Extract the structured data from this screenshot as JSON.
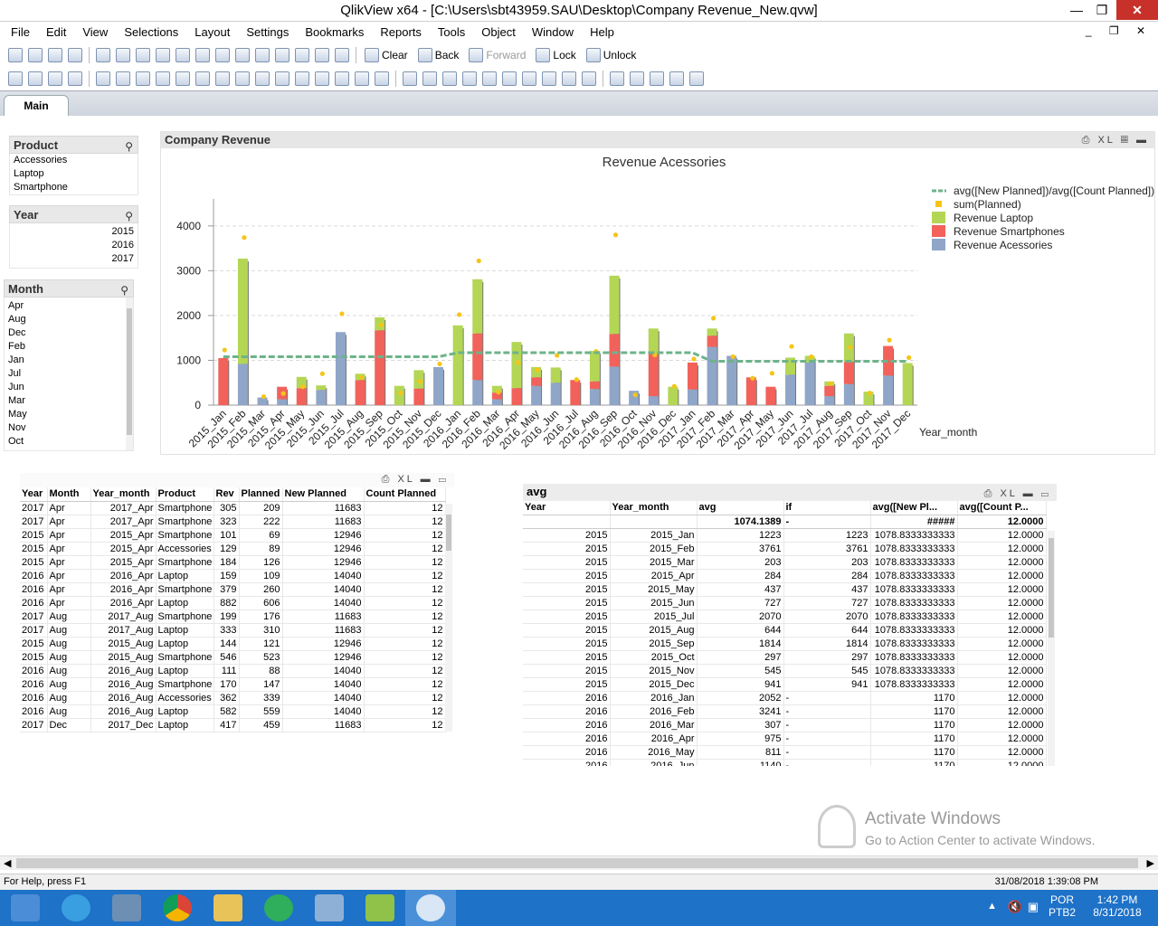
{
  "window": {
    "title": "QlikView x64 - [C:\\Users\\sbt43959.SAU\\Desktop\\Company Revenue_New.qvw]",
    "controls": [
      "—",
      "❐",
      "✕"
    ],
    "mdi_controls": "_ ❐ ✕"
  },
  "menu": [
    "File",
    "Edit",
    "View",
    "Selections",
    "Layout",
    "Settings",
    "Bookmarks",
    "Reports",
    "Tools",
    "Object",
    "Window",
    "Help"
  ],
  "toolbar": {
    "clear": "Clear",
    "back": "Back",
    "forward": "Forward",
    "lock": "Lock",
    "unlock": "Unlock"
  },
  "tabs": [
    {
      "label": "Main"
    }
  ],
  "listboxes": {
    "product": {
      "title": "Product",
      "items": [
        "Accessories",
        "Laptop",
        "Smartphone"
      ]
    },
    "year": {
      "title": "Year",
      "items": [
        "2015",
        "2016",
        "2017"
      ]
    },
    "month": {
      "title": "Month",
      "items": [
        "Apr",
        "Aug",
        "Dec",
        "Feb",
        "Jan",
        "Jul",
        "Jun",
        "Mar",
        "May",
        "Nov",
        "Oct"
      ]
    }
  },
  "chart_object": {
    "caption": "Company Revenue",
    "caption_controls": "XL"
  },
  "chart_data": {
    "type": "bar",
    "title": "Revenue Acessories",
    "xlabel": "Year_month",
    "ylabel": "",
    "ylim": [
      0,
      4400
    ],
    "yticks": [
      0,
      1000,
      2000,
      3000,
      4000
    ],
    "grid": true,
    "legend_position": "top-right",
    "stacked": true,
    "categories": [
      "2015_Jan",
      "2015_Feb",
      "2015_Mar",
      "2015_Apr",
      "2015_May",
      "2015_Jun",
      "2015_Jul",
      "2015_Aug",
      "2015_Sep",
      "2015_Oct",
      "2015_Nov",
      "2015_Dec",
      "2016_Jan",
      "2016_Feb",
      "2016_Mar",
      "2016_Apr",
      "2016_May",
      "2016_Jun",
      "2016_Jul",
      "2016_Aug",
      "2016_Sep",
      "2016_Oct",
      "2016_Nov",
      "2016_Dec",
      "2017_Jan",
      "2017_Feb",
      "2017_Mar",
      "2017_Apr",
      "2017_May",
      "2017_Jun",
      "2017_Jul",
      "2017_Aug",
      "2017_Sep",
      "2017_Oct",
      "2017_Nov",
      "2017_Dec"
    ],
    "series": [
      {
        "name": "Revenue Acessories",
        "kind": "bar",
        "color": "#8fa6c9",
        "values": [
          0,
          920,
          170,
          130,
          0,
          340,
          1630,
          0,
          0,
          0,
          0,
          850,
          0,
          560,
          130,
          0,
          430,
          500,
          0,
          360,
          860,
          320,
          200,
          0,
          350,
          1300,
          1100,
          0,
          0,
          680,
          950,
          200,
          470,
          0,
          660,
          0
        ]
      },
      {
        "name": "Revenue Smartphones",
        "kind": "bar",
        "color": "#f2625a",
        "values": [
          1050,
          0,
          0,
          280,
          380,
          0,
          0,
          560,
          1670,
          0,
          370,
          0,
          0,
          1040,
          150,
          380,
          190,
          0,
          560,
          170,
          730,
          0,
          950,
          0,
          600,
          250,
          0,
          620,
          410,
          0,
          0,
          230,
          500,
          0,
          660,
          0
        ]
      },
      {
        "name": "Revenue Laptop",
        "kind": "bar",
        "color": "#b4d655",
        "values": [
          0,
          2350,
          0,
          0,
          250,
          100,
          0,
          140,
          290,
          430,
          410,
          0,
          1780,
          1210,
          150,
          1030,
          230,
          340,
          0,
          680,
          1300,
          0,
          560,
          410,
          0,
          160,
          0,
          0,
          0,
          380,
          150,
          100,
          630,
          300,
          0,
          940
        ]
      },
      {
        "name": "sum(Planned)",
        "kind": "point",
        "color": "#f5c518",
        "values": [
          1230,
          3740,
          190,
          260,
          410,
          700,
          2040,
          620,
          1790,
          270,
          530,
          920,
          2020,
          3220,
          290,
          950,
          790,
          1110,
          570,
          1200,
          3800,
          230,
          1120,
          420,
          1030,
          1940,
          1080,
          600,
          710,
          1310,
          1080,
          480,
          1290,
          270,
          1450,
          1060
        ]
      },
      {
        "name": "avg([New Planned])/avg([Count Planned])",
        "kind": "line",
        "color": "#6db38a",
        "values": [
          1078.83,
          1078.83,
          1078.83,
          1078.83,
          1078.83,
          1078.83,
          1078.83,
          1078.83,
          1078.83,
          1078.83,
          1078.83,
          1078.83,
          1170,
          1170,
          1170,
          1170,
          1170,
          1170,
          1170,
          1170,
          1170,
          1170,
          1170,
          1170,
          1170,
          978,
          978,
          978,
          978,
          978,
          978,
          978,
          978,
          978,
          978,
          978
        ]
      }
    ]
  },
  "table1": {
    "controls": "XL",
    "headers": [
      "Year",
      "Month",
      "Year_month",
      "Product",
      "Rev",
      "Planned",
      "New Planned",
      "Count Planned"
    ],
    "rows": [
      [
        "2017",
        "Apr",
        "2017_Apr",
        "Smartphone",
        "305",
        "209",
        "11683",
        "12"
      ],
      [
        "2017",
        "Apr",
        "2017_Apr",
        "Smartphone",
        "323",
        "222",
        "11683",
        "12"
      ],
      [
        "2015",
        "Apr",
        "2015_Apr",
        "Smartphone",
        "101",
        "69",
        "12946",
        "12"
      ],
      [
        "2015",
        "Apr",
        "2015_Apr",
        "Accessories",
        "129",
        "89",
        "12946",
        "12"
      ],
      [
        "2015",
        "Apr",
        "2015_Apr",
        "Smartphone",
        "184",
        "126",
        "12946",
        "12"
      ],
      [
        "2016",
        "Apr",
        "2016_Apr",
        "Laptop",
        "159",
        "109",
        "14040",
        "12"
      ],
      [
        "2016",
        "Apr",
        "2016_Apr",
        "Smartphone",
        "379",
        "260",
        "14040",
        "12"
      ],
      [
        "2016",
        "Apr",
        "2016_Apr",
        "Laptop",
        "882",
        "606",
        "14040",
        "12"
      ],
      [
        "2017",
        "Aug",
        "2017_Aug",
        "Smartphone",
        "199",
        "176",
        "11683",
        "12"
      ],
      [
        "2017",
        "Aug",
        "2017_Aug",
        "Laptop",
        "333",
        "310",
        "11683",
        "12"
      ],
      [
        "2015",
        "Aug",
        "2015_Aug",
        "Laptop",
        "144",
        "121",
        "12946",
        "12"
      ],
      [
        "2015",
        "Aug",
        "2015_Aug",
        "Smartphone",
        "546",
        "523",
        "12946",
        "12"
      ],
      [
        "2016",
        "Aug",
        "2016_Aug",
        "Laptop",
        "111",
        "88",
        "14040",
        "12"
      ],
      [
        "2016",
        "Aug",
        "2016_Aug",
        "Smartphone",
        "170",
        "147",
        "14040",
        "12"
      ],
      [
        "2016",
        "Aug",
        "2016_Aug",
        "Accessories",
        "362",
        "339",
        "14040",
        "12"
      ],
      [
        "2016",
        "Aug",
        "2016_Aug",
        "Laptop",
        "582",
        "559",
        "14040",
        "12"
      ],
      [
        "2017",
        "Dec",
        "2017_Dec",
        "Laptop",
        "417",
        "459",
        "11683",
        "12"
      ]
    ]
  },
  "table2": {
    "title": "avg",
    "controls": "XL",
    "headers": [
      "Year",
      "Year_month",
      "avg",
      "if",
      "avg([New Pl...",
      "avg([Count P..."
    ],
    "totals": [
      "",
      "",
      "1074.1389",
      "-",
      "#####",
      "12.0000"
    ],
    "rows": [
      [
        "2015",
        "2015_Jan",
        "1223",
        "1223",
        "1078.8333333333",
        "12.0000"
      ],
      [
        "2015",
        "2015_Feb",
        "3761",
        "3761",
        "1078.8333333333",
        "12.0000"
      ],
      [
        "2015",
        "2015_Mar",
        "203",
        "203",
        "1078.8333333333",
        "12.0000"
      ],
      [
        "2015",
        "2015_Apr",
        "284",
        "284",
        "1078.8333333333",
        "12.0000"
      ],
      [
        "2015",
        "2015_May",
        "437",
        "437",
        "1078.8333333333",
        "12.0000"
      ],
      [
        "2015",
        "2015_Jun",
        "727",
        "727",
        "1078.8333333333",
        "12.0000"
      ],
      [
        "2015",
        "2015_Jul",
        "2070",
        "2070",
        "1078.8333333333",
        "12.0000"
      ],
      [
        "2015",
        "2015_Aug",
        "644",
        "644",
        "1078.8333333333",
        "12.0000"
      ],
      [
        "2015",
        "2015_Sep",
        "1814",
        "1814",
        "1078.8333333333",
        "12.0000"
      ],
      [
        "2015",
        "2015_Oct",
        "297",
        "297",
        "1078.8333333333",
        "12.0000"
      ],
      [
        "2015",
        "2015_Nov",
        "545",
        "545",
        "1078.8333333333",
        "12.0000"
      ],
      [
        "2015",
        "2015_Dec",
        "941",
        "941",
        "1078.8333333333",
        "12.0000"
      ],
      [
        "2016",
        "2016_Jan",
        "2052",
        "-",
        "1170",
        "12.0000"
      ],
      [
        "2016",
        "2016_Feb",
        "3241",
        "-",
        "1170",
        "12.0000"
      ],
      [
        "2016",
        "2016_Mar",
        "307",
        "-",
        "1170",
        "12.0000"
      ],
      [
        "2016",
        "2016_Apr",
        "975",
        "-",
        "1170",
        "12.0000"
      ],
      [
        "2016",
        "2016_May",
        "811",
        "-",
        "1170",
        "12.0000"
      ],
      [
        "2016",
        "2016_Jun",
        "1140",
        "-",
        "1170",
        "12.0000"
      ]
    ]
  },
  "watermark": {
    "title": "Activate Windows",
    "subtitle": "Go to Action Center to activate Windows."
  },
  "status": {
    "help": "For Help, press F1",
    "datetime": "31/08/2018 1:39:08 PM"
  },
  "tray": {
    "lang1": "POR",
    "lang2": "PTB2",
    "time": "1:42 PM",
    "date": "8/31/2018"
  }
}
